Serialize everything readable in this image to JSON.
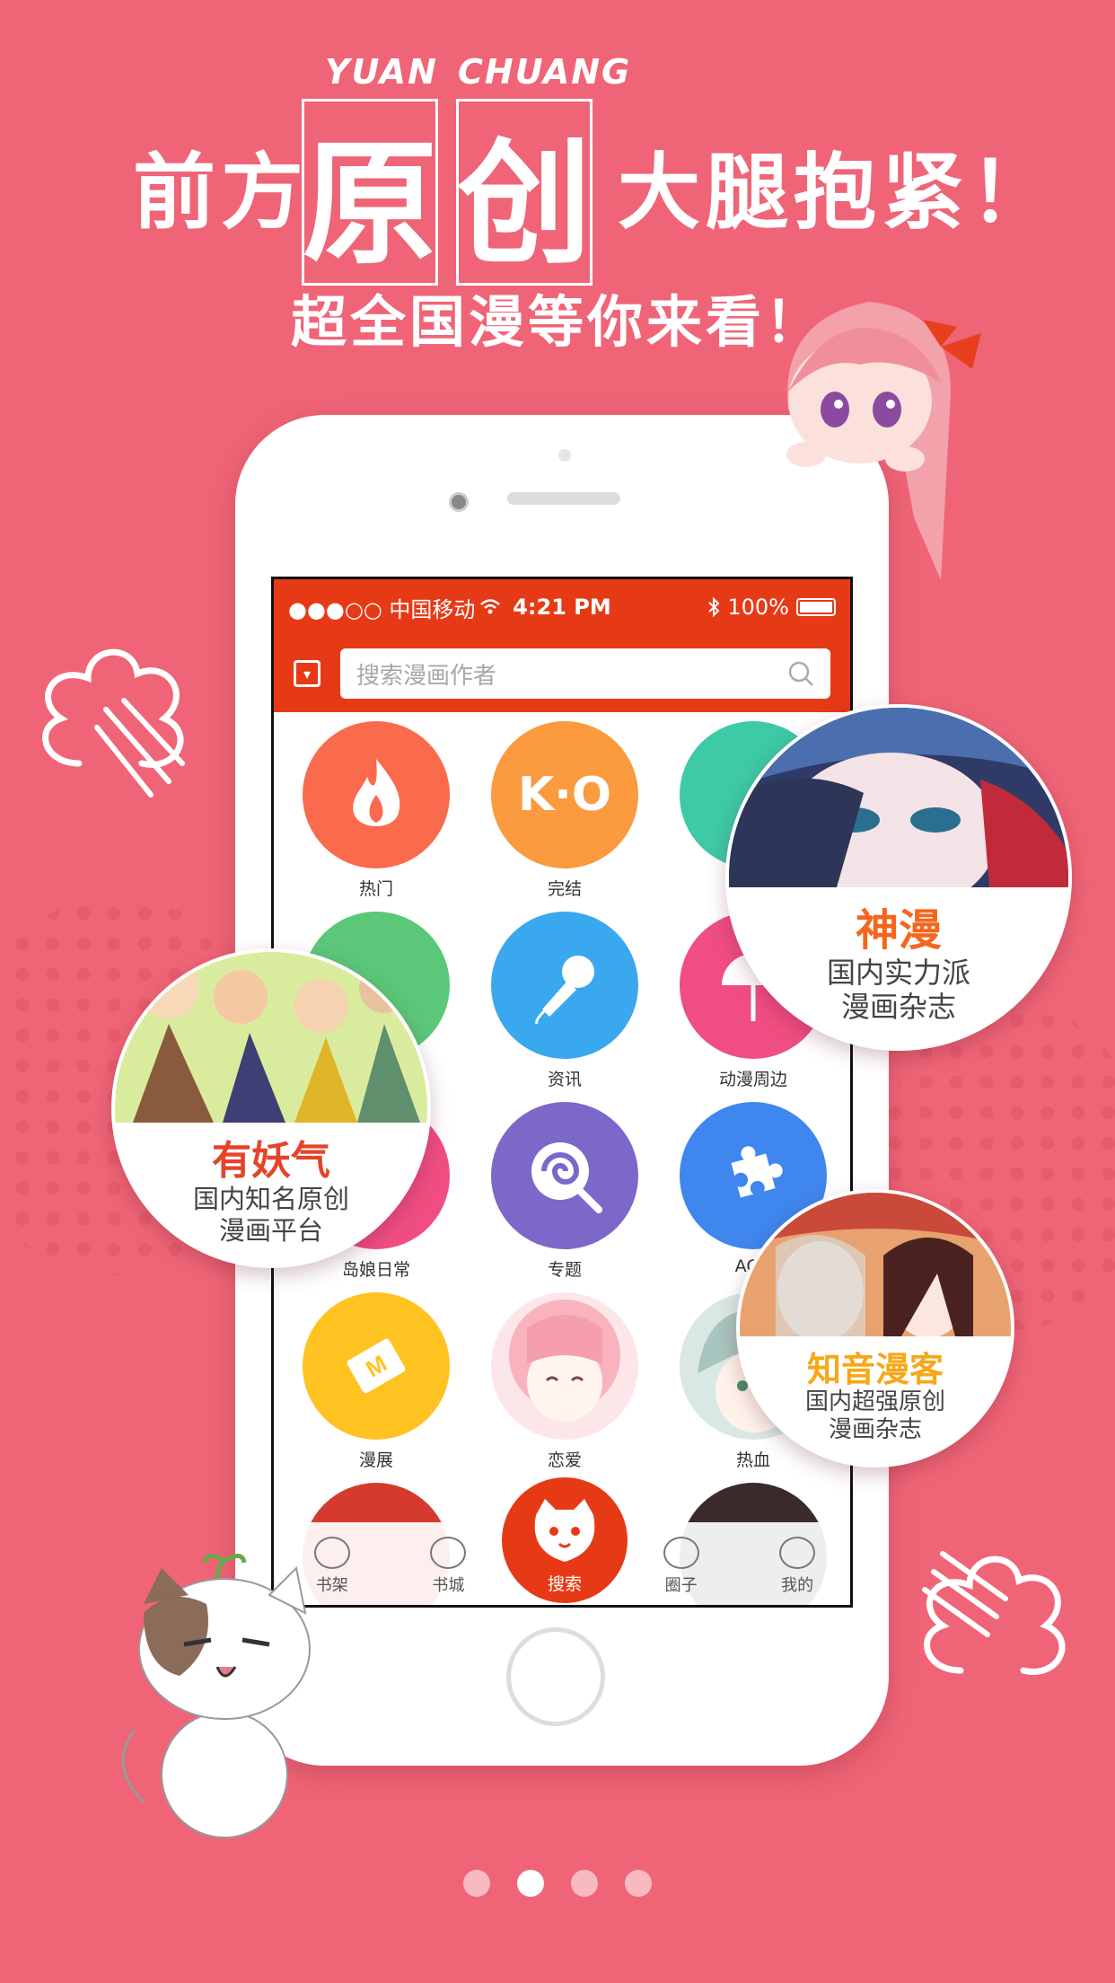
{
  "headline": {
    "pinyin_left": "YUAN",
    "pinyin_right": "CHUANG",
    "left": "前方",
    "box1": "原",
    "box2": "创",
    "right": "大腿抱紧！",
    "sub": "超全国漫等你来看！"
  },
  "statusbar": {
    "carrier": "●●●○○ 中国移动",
    "time": "4:21 PM",
    "battery": "100%"
  },
  "search": {
    "placeholder": "搜索漫画作者"
  },
  "grid": [
    {
      "label": "热门",
      "color": "#fa6a4c",
      "icon": "flame-icon"
    },
    {
      "label": "完结",
      "color": "#fb9a3f",
      "icon": "ko-icon",
      "text": "K·O"
    },
    {
      "label": "",
      "color": "#3ec9a7",
      "icon": "star-icon"
    },
    {
      "label": "",
      "color": "#5bc779",
      "icon": "cup-icon"
    },
    {
      "label": "资讯",
      "color": "#3aa8ee",
      "icon": "microphone-icon"
    },
    {
      "label": "动漫周边",
      "color": "#f04e82",
      "icon": "fan-icon"
    },
    {
      "label": "岛娘日常",
      "color": "#f04e82",
      "icon": "book-icon"
    },
    {
      "label": "专题",
      "color": "#7c68c9",
      "icon": "lollipop-icon"
    },
    {
      "label": "ACG",
      "color": "#3f86ee",
      "icon": "puzzle-icon"
    },
    {
      "label": "漫展",
      "color": "#ffc321",
      "icon": "ticket-icon"
    },
    {
      "label": "恋爱",
      "color": "#f8c6cc",
      "icon": "anime-girl-avatar"
    },
    {
      "label": "热血",
      "color": "#cfe0db",
      "icon": "anime-boy-avatar"
    }
  ],
  "tabs": [
    {
      "label": "书架"
    },
    {
      "label": "书城"
    },
    {
      "label": "搜索"
    },
    {
      "label": "圈子"
    },
    {
      "label": "我的"
    }
  ],
  "bubbles": {
    "shenman": {
      "title": "神漫",
      "desc1": "国内实力派",
      "desc2": "漫画杂志",
      "title_color": "#f5661c"
    },
    "youyaoqi": {
      "title": "有妖气",
      "desc1": "国内知名原创",
      "desc2": "漫画平台",
      "title_color": "#e5442a"
    },
    "zhiyin": {
      "title": "知音漫客",
      "desc1": "国内超强原创",
      "desc2": "漫画杂志",
      "title_color": "#f7a717"
    }
  },
  "pagination": {
    "count": 4,
    "active": 1
  }
}
